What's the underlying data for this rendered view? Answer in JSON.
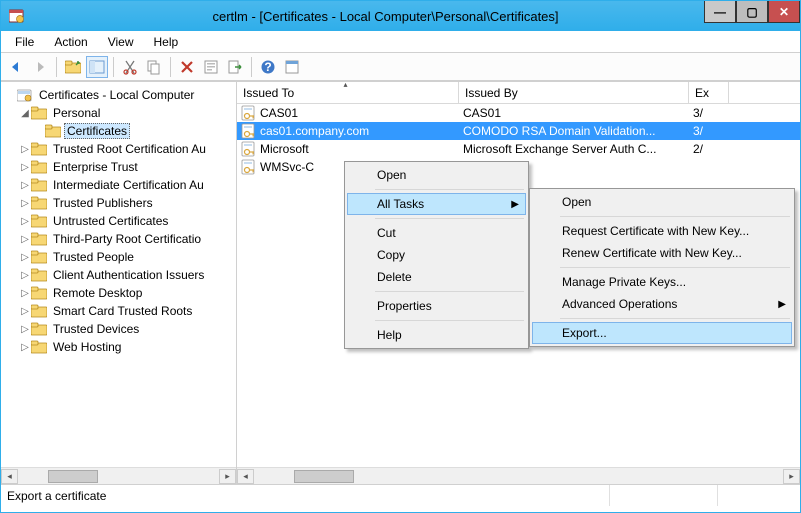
{
  "window": {
    "title": "certlm - [Certificates - Local Computer\\Personal\\Certificates]"
  },
  "menubar": [
    "File",
    "Action",
    "View",
    "Help"
  ],
  "tree": {
    "root": "Certificates - Local Computer",
    "personal": "Personal",
    "certificates": "Certificates",
    "nodes": [
      "Trusted Root Certification Au",
      "Enterprise Trust",
      "Intermediate Certification Au",
      "Trusted Publishers",
      "Untrusted Certificates",
      "Third-Party Root Certificatio",
      "Trusted People",
      "Client Authentication Issuers",
      "Remote Desktop",
      "Smart Card Trusted Roots",
      "Trusted Devices",
      "Web Hosting"
    ]
  },
  "list": {
    "columns": {
      "c1": "Issued To",
      "c2": "Issued By",
      "c3": "Ex"
    },
    "rows": [
      {
        "issuedTo": "CAS01",
        "issuedBy": "CAS01",
        "exp": "3/"
      },
      {
        "issuedTo": "cas01.company.com",
        "issuedBy": "COMODO RSA Domain Validation...",
        "exp": "3/"
      },
      {
        "issuedTo": "Microsoft",
        "issuedBy": "Microsoft Exchange Server Auth C...",
        "exp": "2/"
      },
      {
        "issuedTo": "WMSvc-C",
        "issuedBy": "",
        "exp": ""
      }
    ]
  },
  "ctx1": {
    "open": "Open",
    "alltasks": "All Tasks",
    "cut": "Cut",
    "copy": "Copy",
    "delete": "Delete",
    "properties": "Properties",
    "help": "Help"
  },
  "ctx2": {
    "open": "Open",
    "reqnew": "Request Certificate with New Key...",
    "rennew": "Renew Certificate with New Key...",
    "mpk": "Manage Private Keys...",
    "advops": "Advanced Operations",
    "export": "Export..."
  },
  "status": {
    "text": "Export a certificate"
  }
}
